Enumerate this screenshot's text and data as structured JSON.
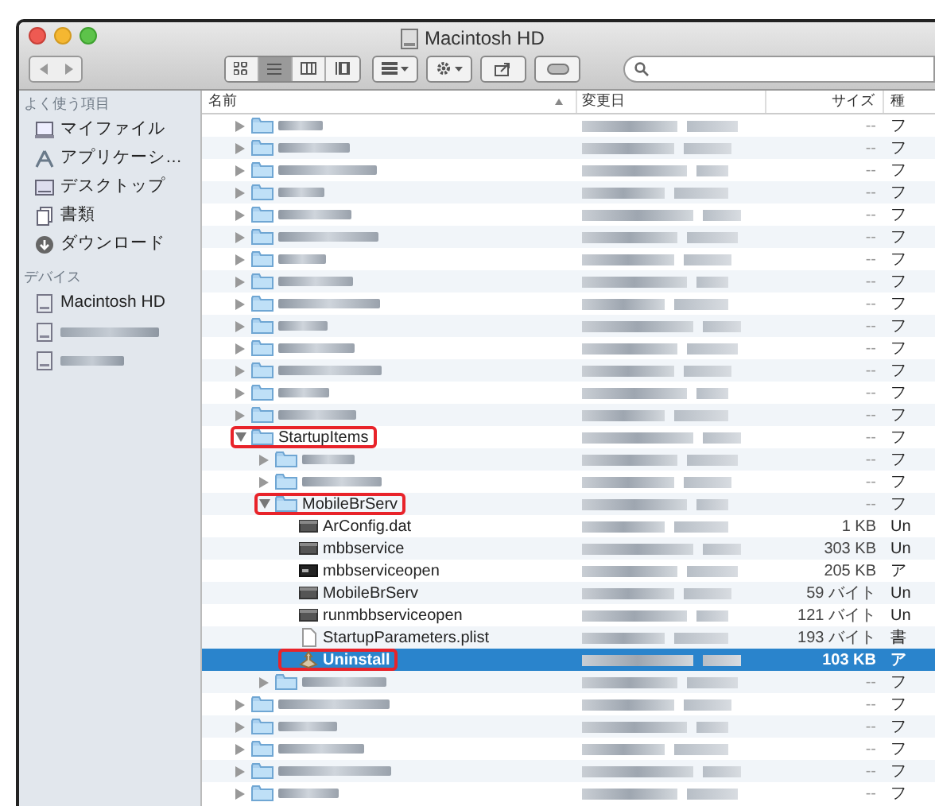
{
  "window": {
    "title": "Macintosh HD"
  },
  "toolbar": {
    "views": [
      {
        "kind": "icons",
        "selected": false
      },
      {
        "kind": "list",
        "selected": true
      },
      {
        "kind": "columns",
        "selected": false
      },
      {
        "kind": "coverflow",
        "selected": false
      }
    ]
  },
  "sidebar": {
    "sections": [
      {
        "title": "よく使う項目",
        "items": [
          {
            "kind": "myfiles",
            "label": "マイファイル"
          },
          {
            "kind": "apps",
            "label": "アプリケーシ…"
          },
          {
            "kind": "desktop",
            "label": "デスクトップ"
          },
          {
            "kind": "documents",
            "label": "書類"
          },
          {
            "kind": "downloads",
            "label": "ダウンロード"
          }
        ]
      },
      {
        "title": "デバイス",
        "items": [
          {
            "kind": "disk",
            "label": "Macintosh HD"
          },
          {
            "kind": "disk"
          },
          {
            "kind": "disk"
          }
        ]
      }
    ]
  },
  "columns": [
    "名前",
    "変更日",
    "サイズ",
    "種"
  ],
  "files": [
    {
      "kind": "folder",
      "expanded": false,
      "size": "--",
      "type": "フ"
    },
    {
      "kind": "folder",
      "expanded": false,
      "size": "--",
      "type": "フ"
    },
    {
      "kind": "folder",
      "expanded": false,
      "size": "--",
      "type": "フ"
    },
    {
      "kind": "folder",
      "expanded": false,
      "size": "--",
      "type": "フ"
    },
    {
      "kind": "folder",
      "expanded": false,
      "size": "--",
      "type": "フ"
    },
    {
      "kind": "folder",
      "expanded": false,
      "size": "--",
      "type": "フ"
    },
    {
      "kind": "folder",
      "expanded": false,
      "size": "--",
      "type": "フ"
    },
    {
      "kind": "folder",
      "expanded": false,
      "size": "--",
      "type": "フ"
    },
    {
      "kind": "folder",
      "expanded": false,
      "size": "--",
      "type": "フ"
    },
    {
      "kind": "folder",
      "expanded": false,
      "size": "--",
      "type": "フ"
    },
    {
      "kind": "folder",
      "expanded": false,
      "size": "--",
      "type": "フ"
    },
    {
      "kind": "folder",
      "expanded": false,
      "size": "--",
      "type": "フ"
    },
    {
      "kind": "folder",
      "expanded": false,
      "size": "--",
      "type": "フ"
    },
    {
      "kind": "folder",
      "expanded": false,
      "size": "--",
      "type": "フ"
    },
    {
      "kind": "folder",
      "name": "StartupItems",
      "expanded": true,
      "highlighted": true,
      "size": "--",
      "type": "フ",
      "children": [
        {
          "kind": "folder",
          "expanded": false,
          "size": "--",
          "type": "フ"
        },
        {
          "kind": "folder",
          "expanded": false,
          "size": "--",
          "type": "フ"
        },
        {
          "kind": "folder",
          "name": "MobileBrServ",
          "expanded": true,
          "highlighted": true,
          "size": "--",
          "type": "フ",
          "children": [
            {
              "kind": "document",
              "name": "ArConfig.dat",
              "size": "1 KB",
              "type": "Un"
            },
            {
              "kind": "document",
              "name": "mbbservice",
              "size": "303 KB",
              "type": "Un"
            },
            {
              "kind": "executable",
              "name": "mbbserviceopen",
              "size": "205 KB",
              "type": "ア"
            },
            {
              "kind": "document",
              "name": "MobileBrServ",
              "size": "59 バイト",
              "type": "Un"
            },
            {
              "kind": "document",
              "name": "runmbbserviceopen",
              "size": "121 バイト",
              "type": "Un"
            },
            {
              "kind": "plist",
              "name": "StartupParameters.plist",
              "size": "193 バイト",
              "type": "書"
            },
            {
              "kind": "app",
              "name": "Uninstall",
              "selected": true,
              "highlighted": true,
              "size": "103 KB",
              "type": "ア"
            }
          ]
        },
        {
          "kind": "folder",
          "expanded": false,
          "size": "--",
          "type": "フ"
        }
      ]
    },
    {
      "kind": "folder",
      "expanded": false,
      "size": "--",
      "type": "フ"
    },
    {
      "kind": "folder",
      "expanded": false,
      "size": "--",
      "type": "フ"
    },
    {
      "kind": "folder",
      "expanded": false,
      "size": "--",
      "type": "フ"
    },
    {
      "kind": "folder",
      "expanded": false,
      "size": "--",
      "type": "フ"
    },
    {
      "kind": "folder",
      "expanded": false,
      "size": "--",
      "type": "フ"
    }
  ]
}
